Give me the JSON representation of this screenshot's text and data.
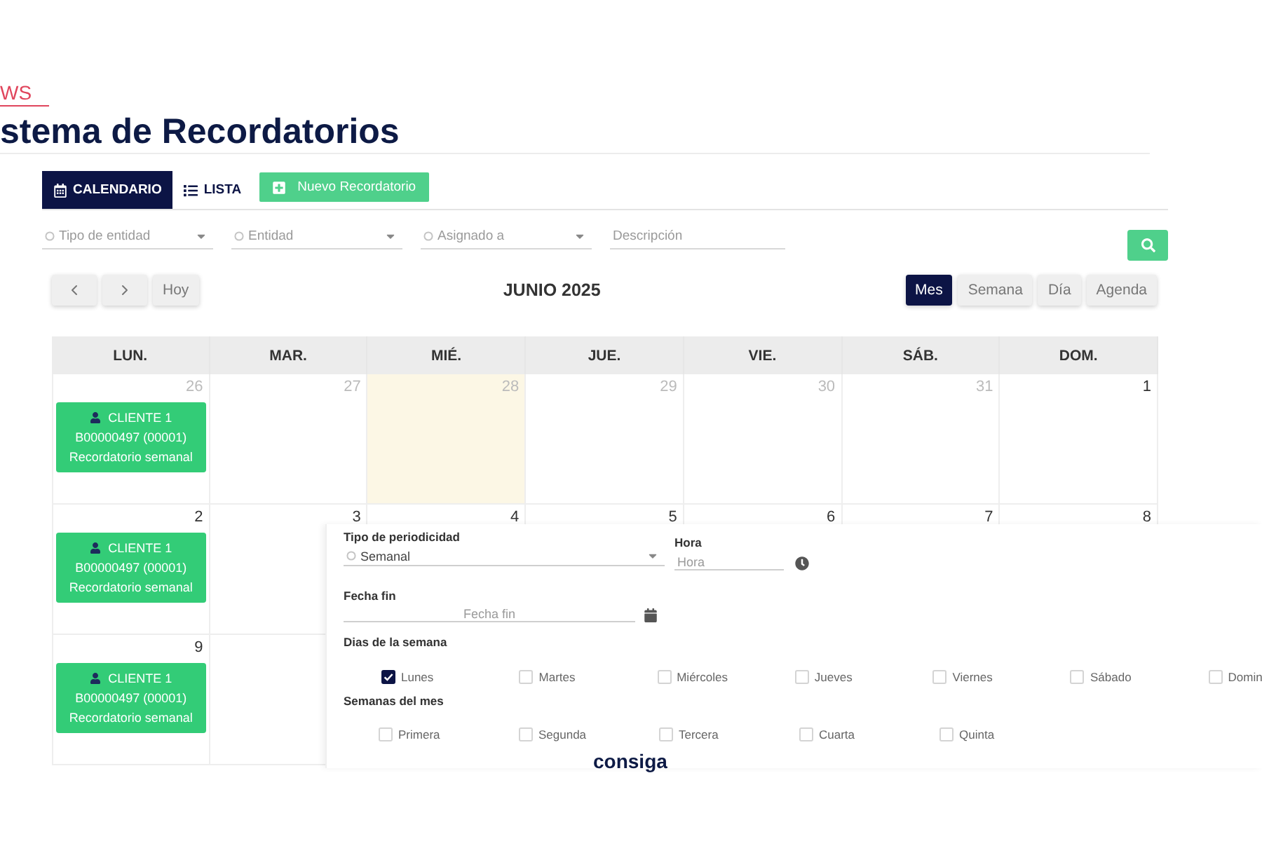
{
  "header": {
    "section": "WS",
    "title": "stema de Recordatorios"
  },
  "tabs": [
    {
      "kind": "calendar",
      "label": "CALENDARIO",
      "selected": true
    },
    {
      "kind": "list",
      "label": "LISTA",
      "selected": false
    }
  ],
  "new_button": {
    "label": "Nuevo Recordatorio"
  },
  "filters": [
    {
      "kind": "select",
      "placeholder": "Tipo de entidad"
    },
    {
      "kind": "select",
      "placeholder": "Entidad"
    },
    {
      "kind": "select",
      "placeholder": "Asignado a"
    },
    {
      "kind": "text",
      "placeholder": "Descripción"
    }
  ],
  "toolbar": {
    "today": "Hoy",
    "period": "JUNIO 2025",
    "views": [
      {
        "label": "Mes",
        "selected": true
      },
      {
        "label": "Semana",
        "selected": false
      },
      {
        "label": "Día",
        "selected": false
      },
      {
        "label": "Agenda",
        "selected": false
      }
    ]
  },
  "calendar": {
    "weekdays": [
      "LUN.",
      "MAR.",
      "MIÉ.",
      "JUE.",
      "VIE.",
      "SÁB.",
      "DOM."
    ],
    "weeks": [
      {
        "days": [
          {
            "number": "26",
            "outside_month": true,
            "today": false,
            "events": [
              {
                "client": "CLIENTE 1",
                "code": "B00000497 (00001)",
                "title": "Recordatorio semanal"
              }
            ]
          },
          {
            "number": "27",
            "outside_month": true,
            "today": false
          },
          {
            "number": "28",
            "outside_month": true,
            "today": true
          },
          {
            "number": "29",
            "outside_month": true,
            "today": false
          },
          {
            "number": "30",
            "outside_month": true,
            "today": false
          },
          {
            "number": "31",
            "outside_month": true,
            "today": false
          },
          {
            "number": "1",
            "outside_month": false,
            "today": false
          }
        ]
      },
      {
        "days": [
          {
            "number": "2",
            "outside_month": false,
            "today": false,
            "events": [
              {
                "client": "CLIENTE 1",
                "code": "B00000497 (00001)",
                "title": "Recordatorio semanal"
              }
            ]
          },
          {
            "number": "3",
            "outside_month": false,
            "today": false
          },
          {
            "number": "4",
            "outside_month": false,
            "today": false
          },
          {
            "number": "5",
            "outside_month": false,
            "today": false
          },
          {
            "number": "6",
            "outside_month": false,
            "today": false
          },
          {
            "number": "7",
            "outside_month": false,
            "today": false
          },
          {
            "number": "8",
            "outside_month": false,
            "today": false
          }
        ]
      },
      {
        "days": [
          {
            "number": "9",
            "outside_month": false,
            "today": false,
            "events": [
              {
                "client": "CLIENTE 1",
                "code": "B00000497 (00001)",
                "title": "Recordatorio semanal"
              }
            ]
          }
        ]
      }
    ]
  },
  "recurrence_form": {
    "periodicity": {
      "label": "Tipo de periodicidad",
      "value": "Semanal"
    },
    "time": {
      "label": "Hora",
      "placeholder": "Hora"
    },
    "end_date": {
      "label": "Fecha fin",
      "placeholder": "Fecha fin"
    },
    "weekdays": {
      "label": "Dias de la semana",
      "options": [
        {
          "label": "Lunes",
          "checked": true
        },
        {
          "label": "Martes",
          "checked": false
        },
        {
          "label": "Miércoles",
          "checked": false
        },
        {
          "label": "Jueves",
          "checked": false
        },
        {
          "label": "Viernes",
          "checked": false
        },
        {
          "label": "Sábado",
          "checked": false
        },
        {
          "label": "Domin",
          "checked": false
        }
      ]
    },
    "month_weeks": {
      "label": "Semanas del mes",
      "options": [
        {
          "label": "Primera",
          "checked": false
        },
        {
          "label": "Segunda",
          "checked": false
        },
        {
          "label": "Tercera",
          "checked": false
        },
        {
          "label": "Cuarta",
          "checked": false
        },
        {
          "label": "Quinta",
          "checked": false
        }
      ]
    }
  },
  "footer": {
    "logo": "consiga"
  }
}
